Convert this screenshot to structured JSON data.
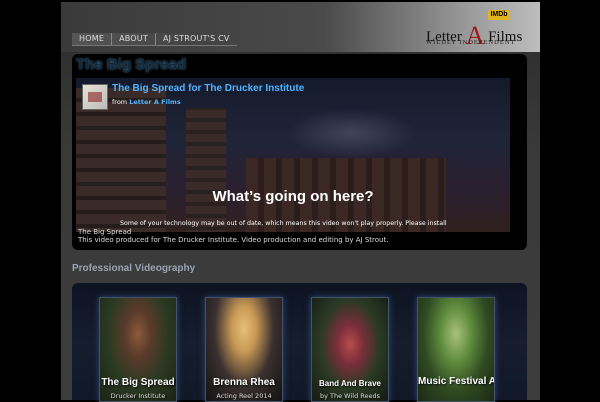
{
  "nav": {
    "items": [
      {
        "label": "HOME"
      },
      {
        "label": "ABOUT"
      },
      {
        "label": "AJ STROUT'S CV"
      }
    ]
  },
  "logo": {
    "pre": "Letter ",
    "big": "A",
    "post": " Films",
    "tagline": "WILDLY INDEPENDENT",
    "badge": "IMDb"
  },
  "video_section": {
    "heading": "The Big Spread",
    "video_title": "The Big Spread for The Drucker Institute",
    "from_label": "from",
    "from_link": "Letter A Films",
    "notice_heading": "What’s going on here?",
    "notice_text": "Some of your technology may be out of date, which means this video won't play properly. Please install",
    "caption_title": "The Big Spread",
    "caption_desc": "This video produced for The Drucker Institute. Video production and editing by AJ Strout."
  },
  "portfolio": {
    "heading": "Professional Videography",
    "cards": [
      {
        "title": "The Big Spread",
        "subtitle": "Drucker Institute"
      },
      {
        "title": "Brenna Rhea",
        "subtitle": "Acting Reel 2014"
      },
      {
        "title": "Band And Brave",
        "subtitle": "by The Wild Reeds"
      },
      {
        "title": "Music Festival Artistic Video",
        "subtitle": ""
      }
    ]
  },
  "colors": {
    "accent_link": "#4fb3ff",
    "logo_red": "#9b1b1b",
    "imdb_yellow": "#e3b51d"
  }
}
